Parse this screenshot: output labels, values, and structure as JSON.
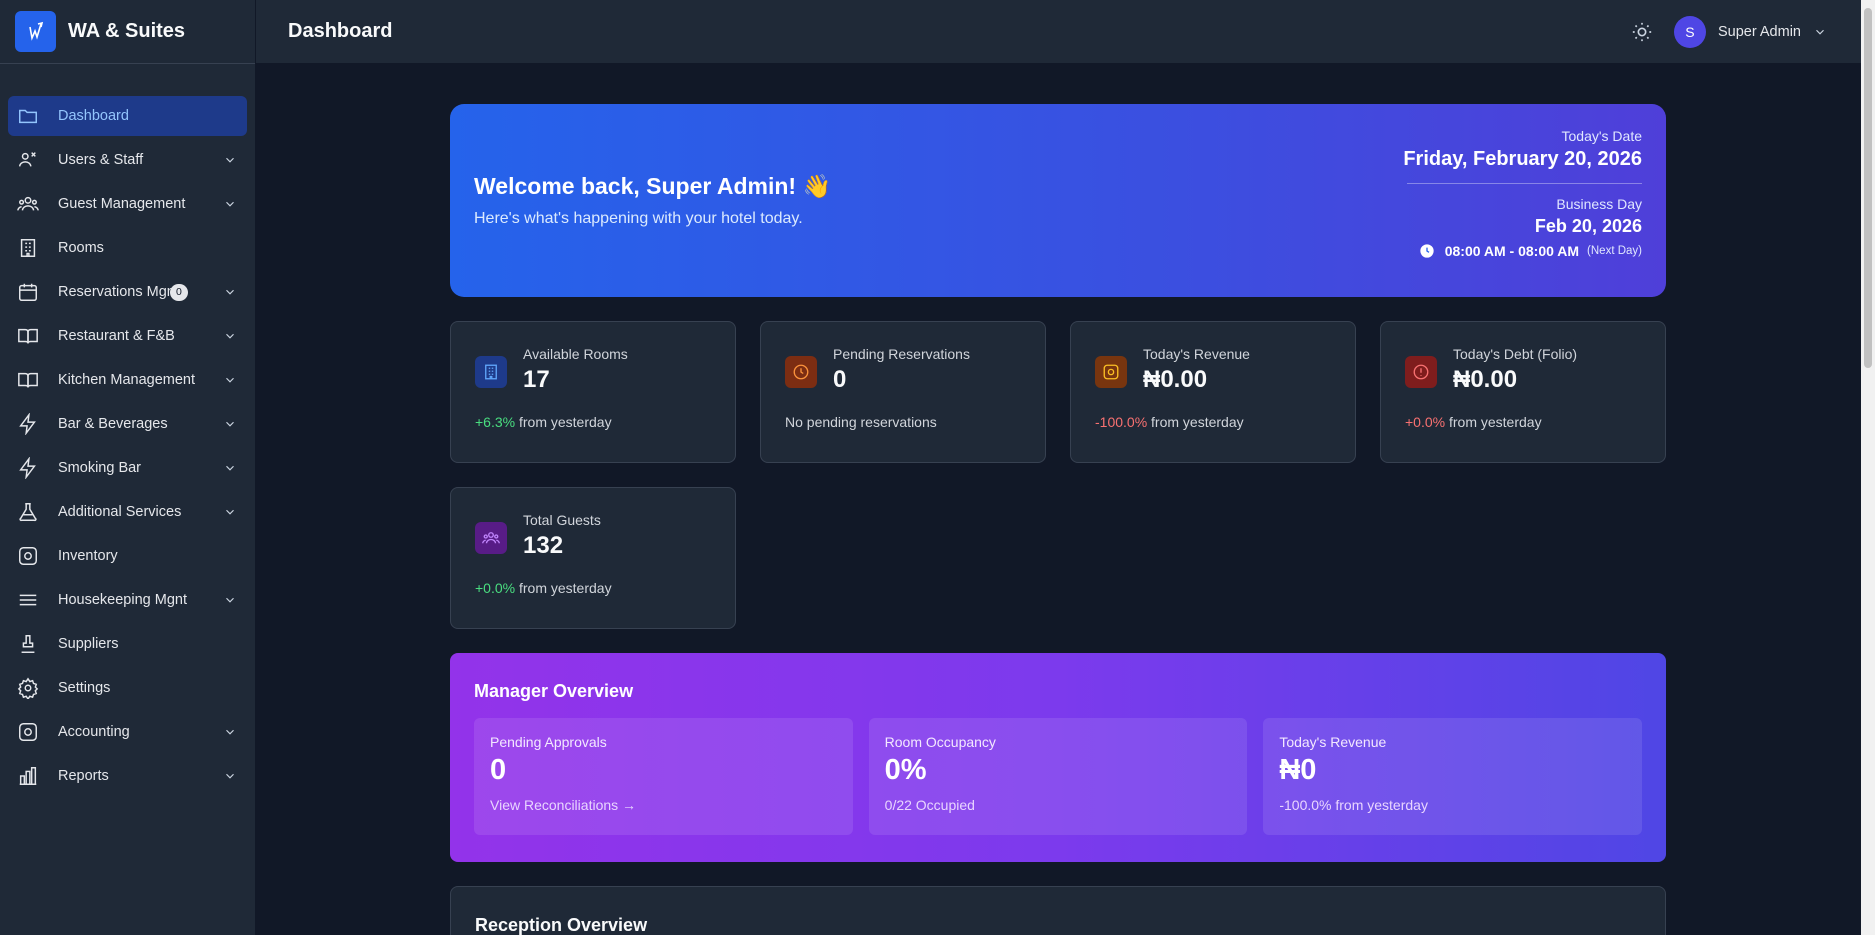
{
  "brand": {
    "name": "WA & Suites"
  },
  "header": {
    "title": "Dashboard",
    "user_initial": "S",
    "user_name": "Super Admin"
  },
  "sidebar": {
    "items": [
      {
        "label": "Dashboard",
        "icon": "folder-icon",
        "active": true,
        "expandable": false
      },
      {
        "label": "Users & Staff",
        "icon": "users-staff-icon",
        "expandable": true
      },
      {
        "label": "Guest Management",
        "icon": "guests-icon",
        "expandable": true
      },
      {
        "label": "Rooms",
        "icon": "building-icon",
        "expandable": false
      },
      {
        "label": "Reservations Mgnt",
        "icon": "calendar-icon",
        "expandable": true,
        "badge": "0"
      },
      {
        "label": "Restaurant & F&B",
        "icon": "book-icon",
        "expandable": true
      },
      {
        "label": "Kitchen Management",
        "icon": "book-icon",
        "expandable": true
      },
      {
        "label": "Bar & Beverages",
        "icon": "lightning-icon",
        "expandable": true
      },
      {
        "label": "Smoking Bar",
        "icon": "lightning-icon",
        "expandable": true
      },
      {
        "label": "Additional Services",
        "icon": "flask-icon",
        "expandable": true
      },
      {
        "label": "Inventory",
        "icon": "box-icon",
        "expandable": false
      },
      {
        "label": "Housekeeping Mgnt",
        "icon": "menu-lines-icon",
        "expandable": true
      },
      {
        "label": "Suppliers",
        "icon": "stamp-icon",
        "expandable": false
      },
      {
        "label": "Settings",
        "icon": "gear-icon",
        "expandable": false
      },
      {
        "label": "Accounting",
        "icon": "box-icon",
        "expandable": true
      },
      {
        "label": "Reports",
        "icon": "bar-chart-icon",
        "expandable": true
      }
    ]
  },
  "welcome": {
    "title": "Welcome back, Super Admin! 👋",
    "subtitle": "Here's what's happening with your hotel today.",
    "today_label": "Today's Date",
    "today_value": "Friday, February 20, 2026",
    "business_label": "Business Day",
    "business_value": "Feb 20, 2026",
    "hours": "08:00 AM - 08:00 AM",
    "next_day": "(Next Day)"
  },
  "stats": [
    {
      "label": "Available Rooms",
      "value": "17",
      "delta": "+6.3%",
      "delta_text": " from yesterday",
      "trend": "pos",
      "icon": "building-icon",
      "bg": "#1e3a8a",
      "fg": "#60a5fa"
    },
    {
      "label": "Pending Reservations",
      "value": "0",
      "delta": "",
      "delta_text": "No pending reservations",
      "trend": "none",
      "icon": "clock-icon",
      "bg": "#7c2d12",
      "fg": "#fb923c"
    },
    {
      "label": "Today's Revenue",
      "value": "₦0.00",
      "delta": "-100.0%",
      "delta_text": " from yesterday",
      "trend": "neg",
      "icon": "box-icon",
      "bg": "#78350f",
      "fg": "#fbbf24"
    },
    {
      "label": "Today's Debt (Folio)",
      "value": "₦0.00",
      "delta": "+0.0%",
      "delta_text": " from yesterday",
      "trend": "neg",
      "icon": "alert-icon",
      "bg": "#7f1d1d",
      "fg": "#f87171"
    },
    {
      "label": "Total Guests",
      "value": "132",
      "delta": "+0.0%",
      "delta_text": " from yesterday",
      "trend": "pos",
      "icon": "guests-icon",
      "bg": "#581c87",
      "fg": "#c084fc"
    }
  ],
  "manager": {
    "title": "Manager Overview",
    "cards": [
      {
        "label": "Pending Approvals",
        "value": "0",
        "foot": "View Reconciliations →"
      },
      {
        "label": "Room Occupancy",
        "value": "0%",
        "foot": "0/22 Occupied"
      },
      {
        "label": "Today's Revenue",
        "value": "₦0",
        "foot": "-100.0% from yesterday"
      }
    ]
  },
  "reception": {
    "title": "Reception Overview"
  }
}
